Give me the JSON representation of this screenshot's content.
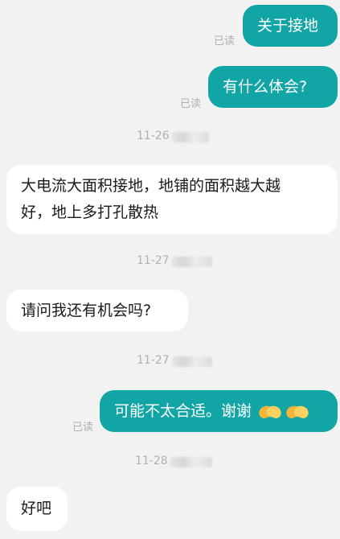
{
  "read_label": "已读",
  "messages": [
    {
      "text": "关于接地"
    },
    {
      "text": "有什么体会?"
    },
    {
      "text": "大电流大面积接地，地铺的面积越大越",
      "text2": "好，地上多打孔散热"
    },
    {
      "text": "请问我还有机会吗?"
    },
    {
      "text": "可能不太合适。谢谢"
    },
    {
      "text": "好吧"
    }
  ],
  "times": [
    "11-26",
    "11-27",
    "11-27",
    "11-28"
  ],
  "emoji": {
    "name": "handshake-icon",
    "count": 2
  }
}
